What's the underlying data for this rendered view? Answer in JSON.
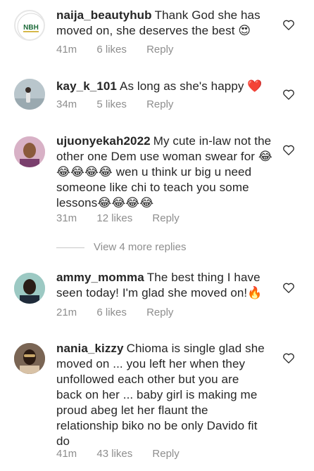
{
  "comments": [
    {
      "username": "naija_beautyhub",
      "text": "Thank God she has moved on, she deserves the best",
      "emoji": "😍",
      "time": "41m",
      "likes": "6 likes",
      "reply": "Reply",
      "avatar_text": "NBH"
    },
    {
      "username": "kay_k_101",
      "text": "As long as she's happy",
      "emoji": "❤️",
      "time": "34m",
      "likes": "5 likes",
      "reply": "Reply"
    },
    {
      "username": "ujuonyekah2022",
      "text_1": "My cute in-law not the other one Dem use woman swear for",
      "text_2": "wen u think ur big u need someone like chi to teach you some lessons",
      "emoji": "😂",
      "time": "31m",
      "likes": "12 likes",
      "reply": "Reply"
    },
    {
      "username": "ammy_momma",
      "text": "The best thing I have seen today! I'm glad she moved on!",
      "emoji": "🔥",
      "time": "21m",
      "likes": "6 likes",
      "reply": "Reply"
    },
    {
      "username": "nania_kizzy",
      "text": "Chioma is single glad she moved on ... you left her when they unfollowed each other but you are back on her ... baby girl is making me proud abeg let her flaunt the relationship biko no be only Davido fit do",
      "time": "41m",
      "likes": "43 likes",
      "reply": "Reply"
    }
  ],
  "view_more_label": "View 4 more replies",
  "colors": {
    "text": "#262626",
    "meta": "#8e8e8e",
    "divider": "#c7c7c7",
    "heart_outline": "#262626"
  },
  "icons": {
    "like": "heart-outline-icon"
  }
}
